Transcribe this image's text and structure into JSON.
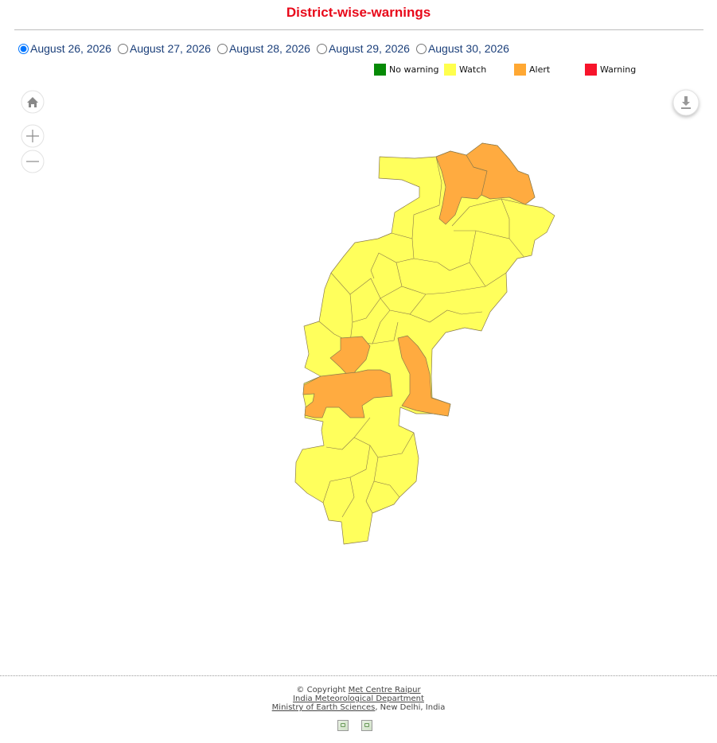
{
  "title": "District-wise-warnings",
  "dates": [
    {
      "label": "August 26, 2026",
      "checked": true
    },
    {
      "label": "August 27, 2026",
      "checked": false
    },
    {
      "label": "August 28, 2026",
      "checked": false
    },
    {
      "label": "August 29, 2026",
      "checked": false
    },
    {
      "label": "August 30, 2026",
      "checked": false
    }
  ],
  "legend": [
    {
      "label": "No warning",
      "color": "#068a06"
    },
    {
      "label": "Watch",
      "color": "#ffff4d"
    },
    {
      "label": "Alert",
      "color": "#ffa833"
    },
    {
      "label": "Warning",
      "color": "#f7142b"
    }
  ],
  "map": {
    "district_colors": {
      "watch": "#ffff5c",
      "alert": "#ffab40"
    },
    "icons": {
      "home": "home-icon",
      "zoom_in": "plus-icon",
      "zoom_out": "minus-icon",
      "download": "download-icon"
    }
  },
  "footer": {
    "copyright_prefix": "© Copyright",
    "org1": "Met Centre Raipur",
    "org2": "India Meteorological Department",
    "org3": "Ministry of Earth Sciences",
    "org3_suffix": ", New Delhi, India"
  }
}
